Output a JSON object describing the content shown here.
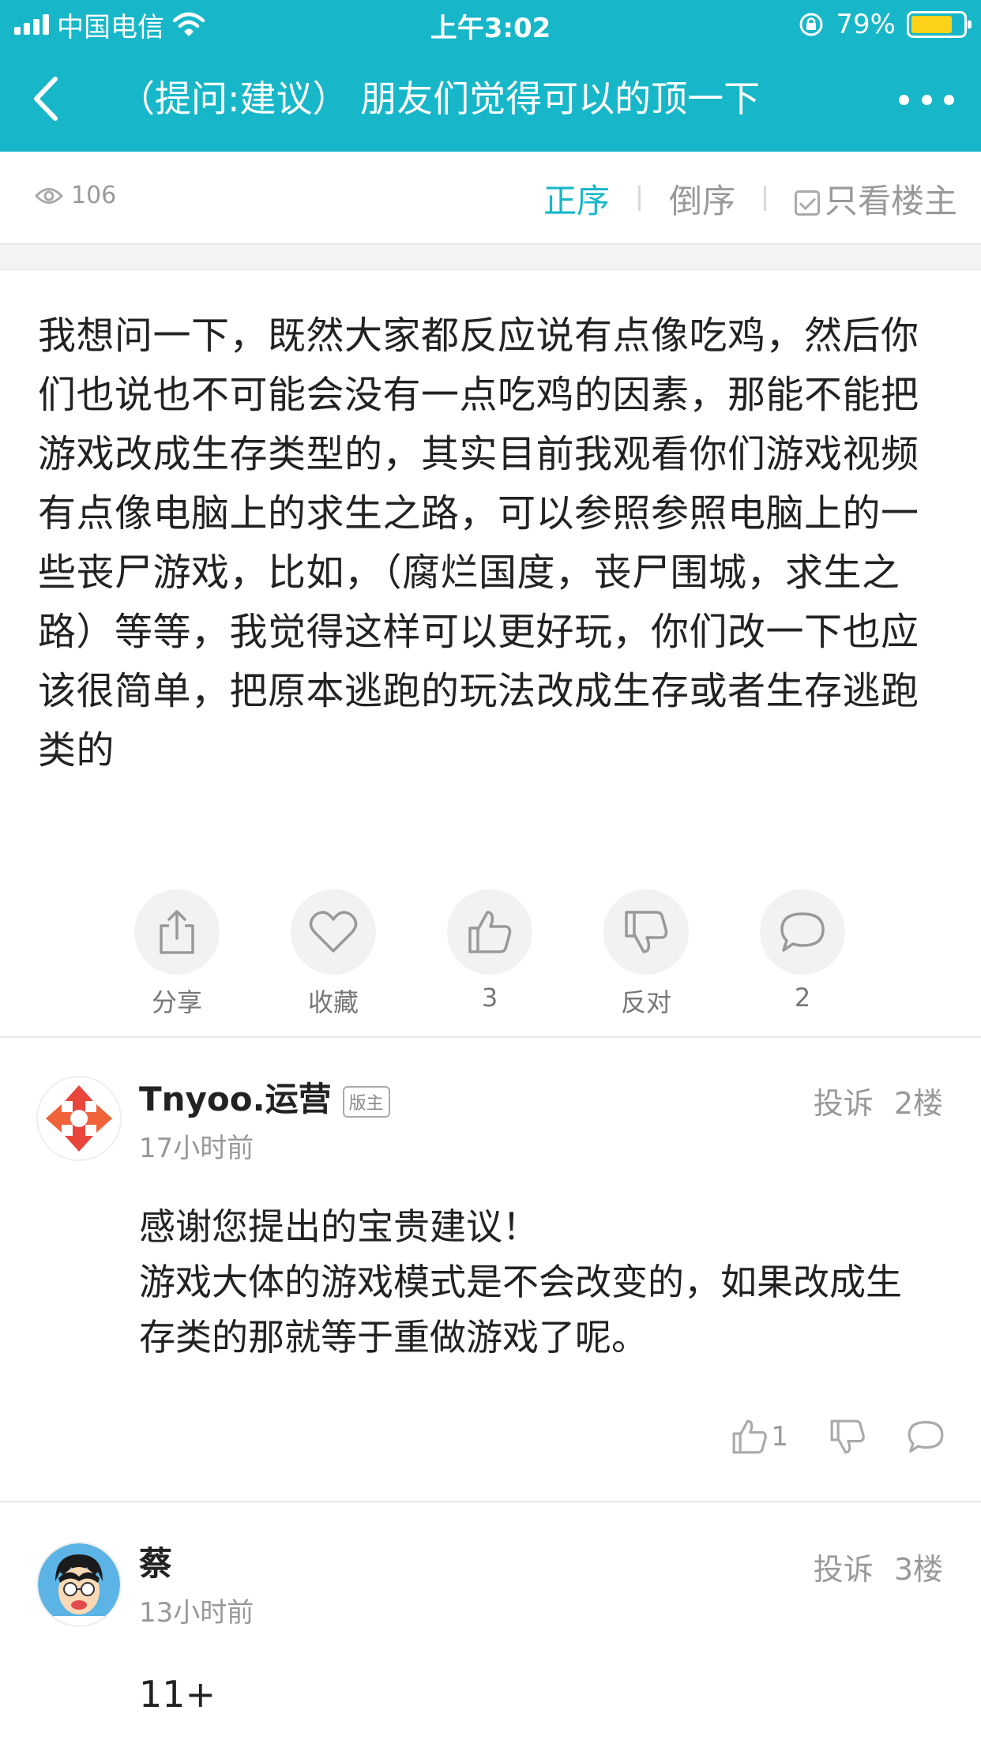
{
  "status_bar": {
    "carrier": "中国电信",
    "time": "上午3:02",
    "battery_percent": "79%",
    "battery_level": 0.79,
    "battery_color": "#ffd21a"
  },
  "nav": {
    "title": "（提问:建议） 朋友们觉得可以的顶一下",
    "back_icon": "chevron-left-icon",
    "more_icon": "more-dots-icon"
  },
  "sort_bar": {
    "view_count": "106",
    "order_asc": "正序",
    "order_desc": "倒序",
    "owner_only": "只看楼主"
  },
  "post": {
    "body": "我想问一下，既然大家都反应说有点像吃鸡，然后你们也说也不可能会没有一点吃鸡的因素，那能不能把游戏改成生存类型的，其实目前我观看你们游戏视频有点像电脑上的求生之路，可以参照参照电脑上的一些丧尸游戏，比如，（腐烂国度，丧尸围城，求生之路）等等，我觉得这样可以更好玩，你们改一下也应该很简单，把原本逃跑的玩法改成生存或者生存逃跑类的",
    "actions": [
      {
        "label": "分享",
        "icon": "share-icon"
      },
      {
        "label": "收藏",
        "icon": "heart-icon"
      },
      {
        "label": "3",
        "icon": "thumbs-up-icon"
      },
      {
        "label": "反对",
        "icon": "thumbs-down-icon"
      },
      {
        "label": "2",
        "icon": "comment-icon"
      }
    ]
  },
  "comments": [
    {
      "author": "Tnyoo.运营",
      "badge": "版主",
      "time": "17小时前",
      "report": "投诉",
      "floor": "2楼",
      "text_lines": [
        "感谢您提出的宝贵建议！",
        "游戏大体的游戏模式是不会改变的，如果改成生存类的那就等于重做游戏了呢。"
      ],
      "likes": "1"
    },
    {
      "author": "蔡",
      "time": "13小时前",
      "report": "投诉",
      "floor": "3楼",
      "text": "11+"
    }
  ],
  "colors": {
    "accent": "#17b7c9",
    "text": "#222222",
    "muted": "#999999"
  }
}
